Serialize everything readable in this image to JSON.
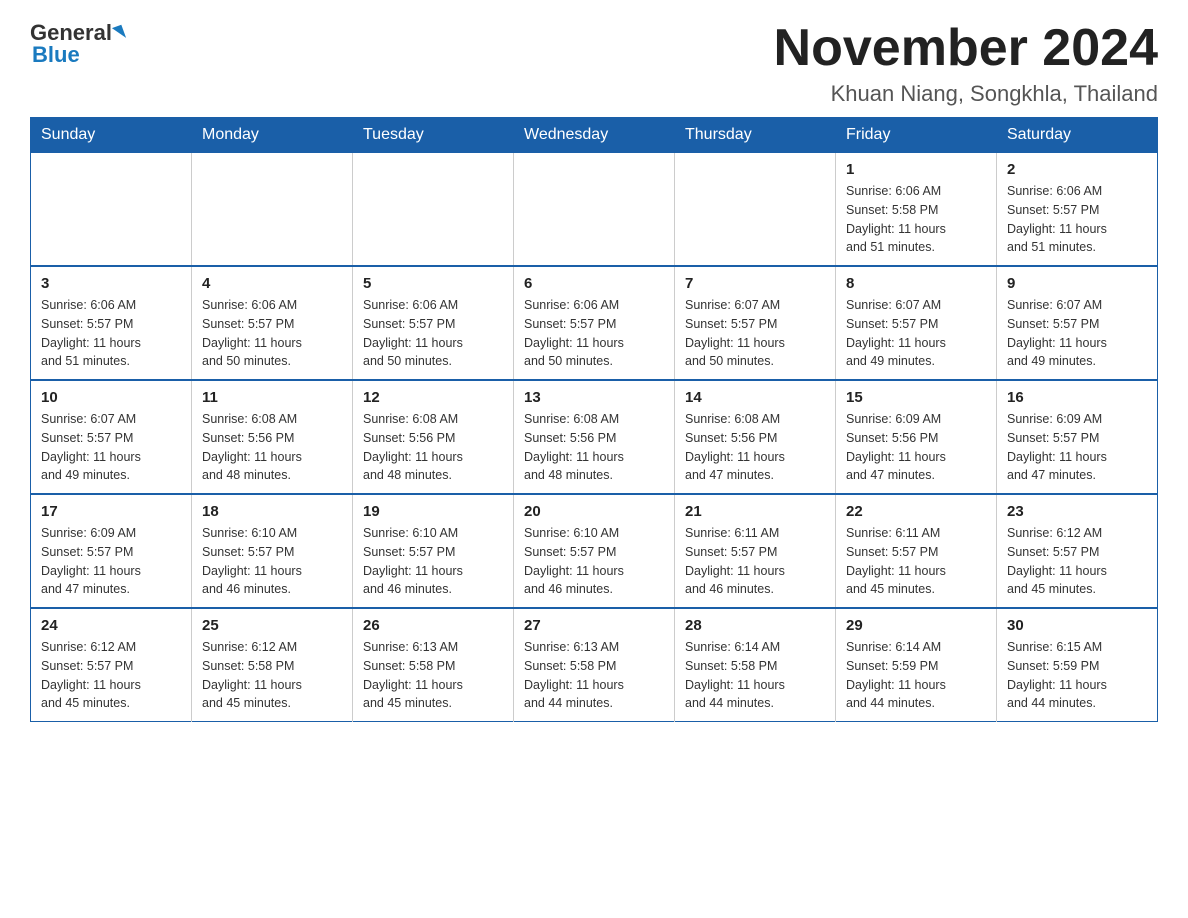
{
  "header": {
    "logo_general": "General",
    "logo_blue": "Blue",
    "month_year": "November 2024",
    "location": "Khuan Niang, Songkhla, Thailand"
  },
  "days_of_week": [
    "Sunday",
    "Monday",
    "Tuesday",
    "Wednesday",
    "Thursday",
    "Friday",
    "Saturday"
  ],
  "weeks": [
    [
      {
        "day": "",
        "info": ""
      },
      {
        "day": "",
        "info": ""
      },
      {
        "day": "",
        "info": ""
      },
      {
        "day": "",
        "info": ""
      },
      {
        "day": "",
        "info": ""
      },
      {
        "day": "1",
        "info": "Sunrise: 6:06 AM\nSunset: 5:58 PM\nDaylight: 11 hours\nand 51 minutes."
      },
      {
        "day": "2",
        "info": "Sunrise: 6:06 AM\nSunset: 5:57 PM\nDaylight: 11 hours\nand 51 minutes."
      }
    ],
    [
      {
        "day": "3",
        "info": "Sunrise: 6:06 AM\nSunset: 5:57 PM\nDaylight: 11 hours\nand 51 minutes."
      },
      {
        "day": "4",
        "info": "Sunrise: 6:06 AM\nSunset: 5:57 PM\nDaylight: 11 hours\nand 50 minutes."
      },
      {
        "day": "5",
        "info": "Sunrise: 6:06 AM\nSunset: 5:57 PM\nDaylight: 11 hours\nand 50 minutes."
      },
      {
        "day": "6",
        "info": "Sunrise: 6:06 AM\nSunset: 5:57 PM\nDaylight: 11 hours\nand 50 minutes."
      },
      {
        "day": "7",
        "info": "Sunrise: 6:07 AM\nSunset: 5:57 PM\nDaylight: 11 hours\nand 50 minutes."
      },
      {
        "day": "8",
        "info": "Sunrise: 6:07 AM\nSunset: 5:57 PM\nDaylight: 11 hours\nand 49 minutes."
      },
      {
        "day": "9",
        "info": "Sunrise: 6:07 AM\nSunset: 5:57 PM\nDaylight: 11 hours\nand 49 minutes."
      }
    ],
    [
      {
        "day": "10",
        "info": "Sunrise: 6:07 AM\nSunset: 5:57 PM\nDaylight: 11 hours\nand 49 minutes."
      },
      {
        "day": "11",
        "info": "Sunrise: 6:08 AM\nSunset: 5:56 PM\nDaylight: 11 hours\nand 48 minutes."
      },
      {
        "day": "12",
        "info": "Sunrise: 6:08 AM\nSunset: 5:56 PM\nDaylight: 11 hours\nand 48 minutes."
      },
      {
        "day": "13",
        "info": "Sunrise: 6:08 AM\nSunset: 5:56 PM\nDaylight: 11 hours\nand 48 minutes."
      },
      {
        "day": "14",
        "info": "Sunrise: 6:08 AM\nSunset: 5:56 PM\nDaylight: 11 hours\nand 47 minutes."
      },
      {
        "day": "15",
        "info": "Sunrise: 6:09 AM\nSunset: 5:56 PM\nDaylight: 11 hours\nand 47 minutes."
      },
      {
        "day": "16",
        "info": "Sunrise: 6:09 AM\nSunset: 5:57 PM\nDaylight: 11 hours\nand 47 minutes."
      }
    ],
    [
      {
        "day": "17",
        "info": "Sunrise: 6:09 AM\nSunset: 5:57 PM\nDaylight: 11 hours\nand 47 minutes."
      },
      {
        "day": "18",
        "info": "Sunrise: 6:10 AM\nSunset: 5:57 PM\nDaylight: 11 hours\nand 46 minutes."
      },
      {
        "day": "19",
        "info": "Sunrise: 6:10 AM\nSunset: 5:57 PM\nDaylight: 11 hours\nand 46 minutes."
      },
      {
        "day": "20",
        "info": "Sunrise: 6:10 AM\nSunset: 5:57 PM\nDaylight: 11 hours\nand 46 minutes."
      },
      {
        "day": "21",
        "info": "Sunrise: 6:11 AM\nSunset: 5:57 PM\nDaylight: 11 hours\nand 46 minutes."
      },
      {
        "day": "22",
        "info": "Sunrise: 6:11 AM\nSunset: 5:57 PM\nDaylight: 11 hours\nand 45 minutes."
      },
      {
        "day": "23",
        "info": "Sunrise: 6:12 AM\nSunset: 5:57 PM\nDaylight: 11 hours\nand 45 minutes."
      }
    ],
    [
      {
        "day": "24",
        "info": "Sunrise: 6:12 AM\nSunset: 5:57 PM\nDaylight: 11 hours\nand 45 minutes."
      },
      {
        "day": "25",
        "info": "Sunrise: 6:12 AM\nSunset: 5:58 PM\nDaylight: 11 hours\nand 45 minutes."
      },
      {
        "day": "26",
        "info": "Sunrise: 6:13 AM\nSunset: 5:58 PM\nDaylight: 11 hours\nand 45 minutes."
      },
      {
        "day": "27",
        "info": "Sunrise: 6:13 AM\nSunset: 5:58 PM\nDaylight: 11 hours\nand 44 minutes."
      },
      {
        "day": "28",
        "info": "Sunrise: 6:14 AM\nSunset: 5:58 PM\nDaylight: 11 hours\nand 44 minutes."
      },
      {
        "day": "29",
        "info": "Sunrise: 6:14 AM\nSunset: 5:59 PM\nDaylight: 11 hours\nand 44 minutes."
      },
      {
        "day": "30",
        "info": "Sunrise: 6:15 AM\nSunset: 5:59 PM\nDaylight: 11 hours\nand 44 minutes."
      }
    ]
  ]
}
